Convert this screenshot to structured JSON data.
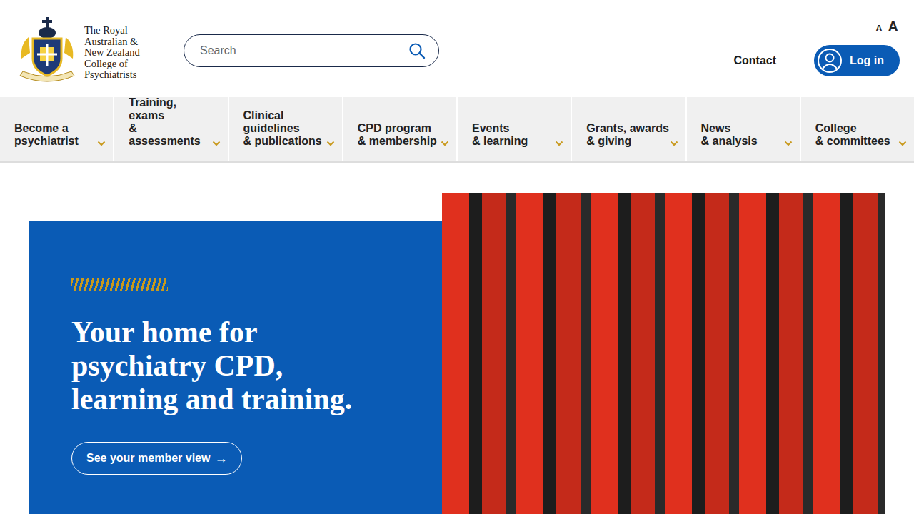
{
  "logo": {
    "lines": [
      "The Royal",
      "Australian &",
      "New Zealand",
      "College of",
      "Psychiatrists"
    ]
  },
  "search": {
    "placeholder": "Search"
  },
  "font_size_controls": [
    {
      "label": "A",
      "size": "small"
    },
    {
      "label": "A",
      "size": "large"
    }
  ],
  "header_links": {
    "contact": "Contact",
    "login": "Log in"
  },
  "nav": [
    {
      "lines": [
        "Become a",
        "psychiatrist"
      ]
    },
    {
      "lines": [
        "Training,",
        "exams",
        "& assessments"
      ]
    },
    {
      "lines": [
        "Clinical",
        "guidelines",
        "& publications"
      ]
    },
    {
      "lines": [
        "CPD program",
        "& membership"
      ]
    },
    {
      "lines": [
        "Events",
        "& learning"
      ]
    },
    {
      "lines": [
        "Grants, awards",
        "& giving"
      ]
    },
    {
      "lines": [
        "News",
        "& analysis"
      ]
    },
    {
      "lines": [
        "College",
        "& committees"
      ]
    }
  ],
  "hero": {
    "heading_lines": [
      "Your home for",
      "psychiatry CPD,",
      "learning and training."
    ],
    "button": "See your member view",
    "button_arrow": "→"
  }
}
